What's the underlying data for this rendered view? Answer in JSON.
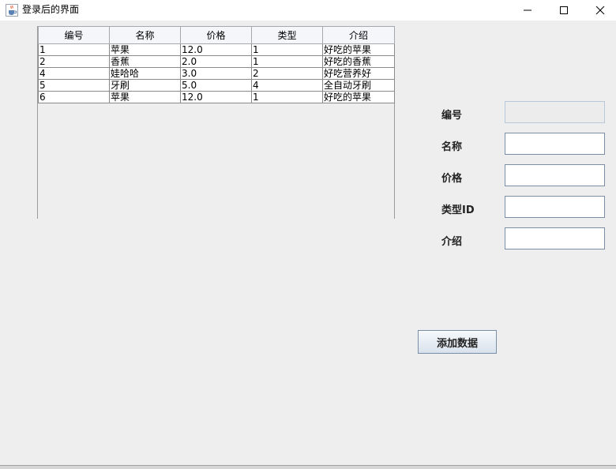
{
  "window": {
    "title": "登录后的界面",
    "icon": "java-cup-icon"
  },
  "table": {
    "columns": [
      "编号",
      "名称",
      "价格",
      "类型",
      "介绍"
    ],
    "rows": [
      [
        "1",
        "苹果",
        "12.0",
        "1",
        "好吃的苹果"
      ],
      [
        "2",
        "香蕉",
        "2.0",
        "1",
        "好吃的香蕉"
      ],
      [
        "4",
        "娃哈哈",
        "3.0",
        "2",
        "好吃营养好"
      ],
      [
        "5",
        "牙刷",
        "5.0",
        "4",
        "全自动牙刷"
      ],
      [
        "6",
        "苹果",
        "12.0",
        "1",
        "好吃的苹果"
      ]
    ]
  },
  "form": {
    "id_label": "编号",
    "id_value": "",
    "name_label": "名称",
    "name_value": "",
    "price_label": "价格",
    "price_value": "",
    "type_label": "类型ID",
    "type_value": "",
    "desc_label": "介绍",
    "desc_value": ""
  },
  "buttons": {
    "add_label": "添加数据"
  }
}
